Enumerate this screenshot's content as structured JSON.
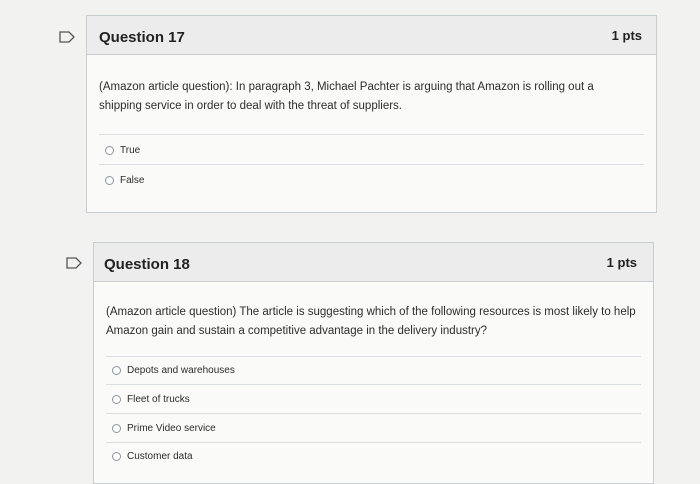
{
  "questions": [
    {
      "title": "Question 17",
      "points": "1 pts",
      "text": "(Amazon article question): In paragraph 3, Michael Pachter is arguing that Amazon is rolling out a shipping service in order to deal with the threat of suppliers.",
      "answers": [
        "True",
        "False"
      ]
    },
    {
      "title": "Question 18",
      "points": "1 pts",
      "text": "(Amazon article question) The article is suggesting which of the following resources is most likely to help Amazon gain and sustain a competitive advantage in the delivery industry?",
      "answers": [
        "Depots and warehouses",
        "Fleet of trucks",
        "Prime Video service",
        "Customer data"
      ]
    }
  ],
  "colors": {
    "background": "#f2f2f1",
    "header": "#ececec",
    "border": "#c7cdd1",
    "text": "#2d2d2d"
  }
}
